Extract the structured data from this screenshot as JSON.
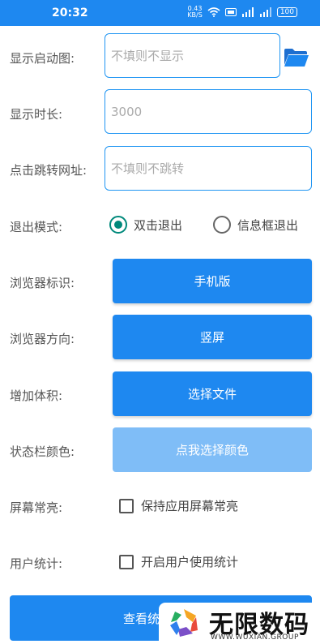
{
  "status_bar": {
    "time": "20:32",
    "net_speed_value": "0.43",
    "net_speed_unit": "KB/S",
    "battery": "100"
  },
  "form": {
    "splash": {
      "label": "显示启动图:",
      "placeholder": "不填则不显示",
      "value": ""
    },
    "duration": {
      "label": "显示时长:",
      "placeholder": "3000",
      "value": ""
    },
    "jump_url": {
      "label": "点击跳转网址:",
      "placeholder": "不填则不跳转",
      "value": ""
    },
    "exit_mode": {
      "label": "退出模式:",
      "options": [
        {
          "label": "双击退出",
          "selected": true
        },
        {
          "label": "信息框退出",
          "selected": false
        }
      ]
    },
    "browser_ua": {
      "label": "浏览器标识:",
      "button": "手机版"
    },
    "browser_orientation": {
      "label": "浏览器方向:",
      "button": "竖屏"
    },
    "add_size": {
      "label": "增加体积:",
      "button": "选择文件"
    },
    "statusbar_color": {
      "label": "状态栏颜色:",
      "button": "点我选择颜色"
    },
    "screen_on": {
      "label": "屏幕常亮:",
      "checkbox": "保持应用屏幕常亮",
      "checked": false
    },
    "user_stats": {
      "label": "用户统计:",
      "checkbox": "开启用户使用统计",
      "checked": false
    },
    "bottom_button": "查看统"
  },
  "watermark": {
    "title": "无限数码",
    "subtitle": "WWW.WUXIAN.GROUP"
  },
  "colors": {
    "primary": "#1e88f0",
    "primary_light": "#7fbdf7",
    "radio_checked": "#00897b",
    "input_border": "#2196f3"
  }
}
